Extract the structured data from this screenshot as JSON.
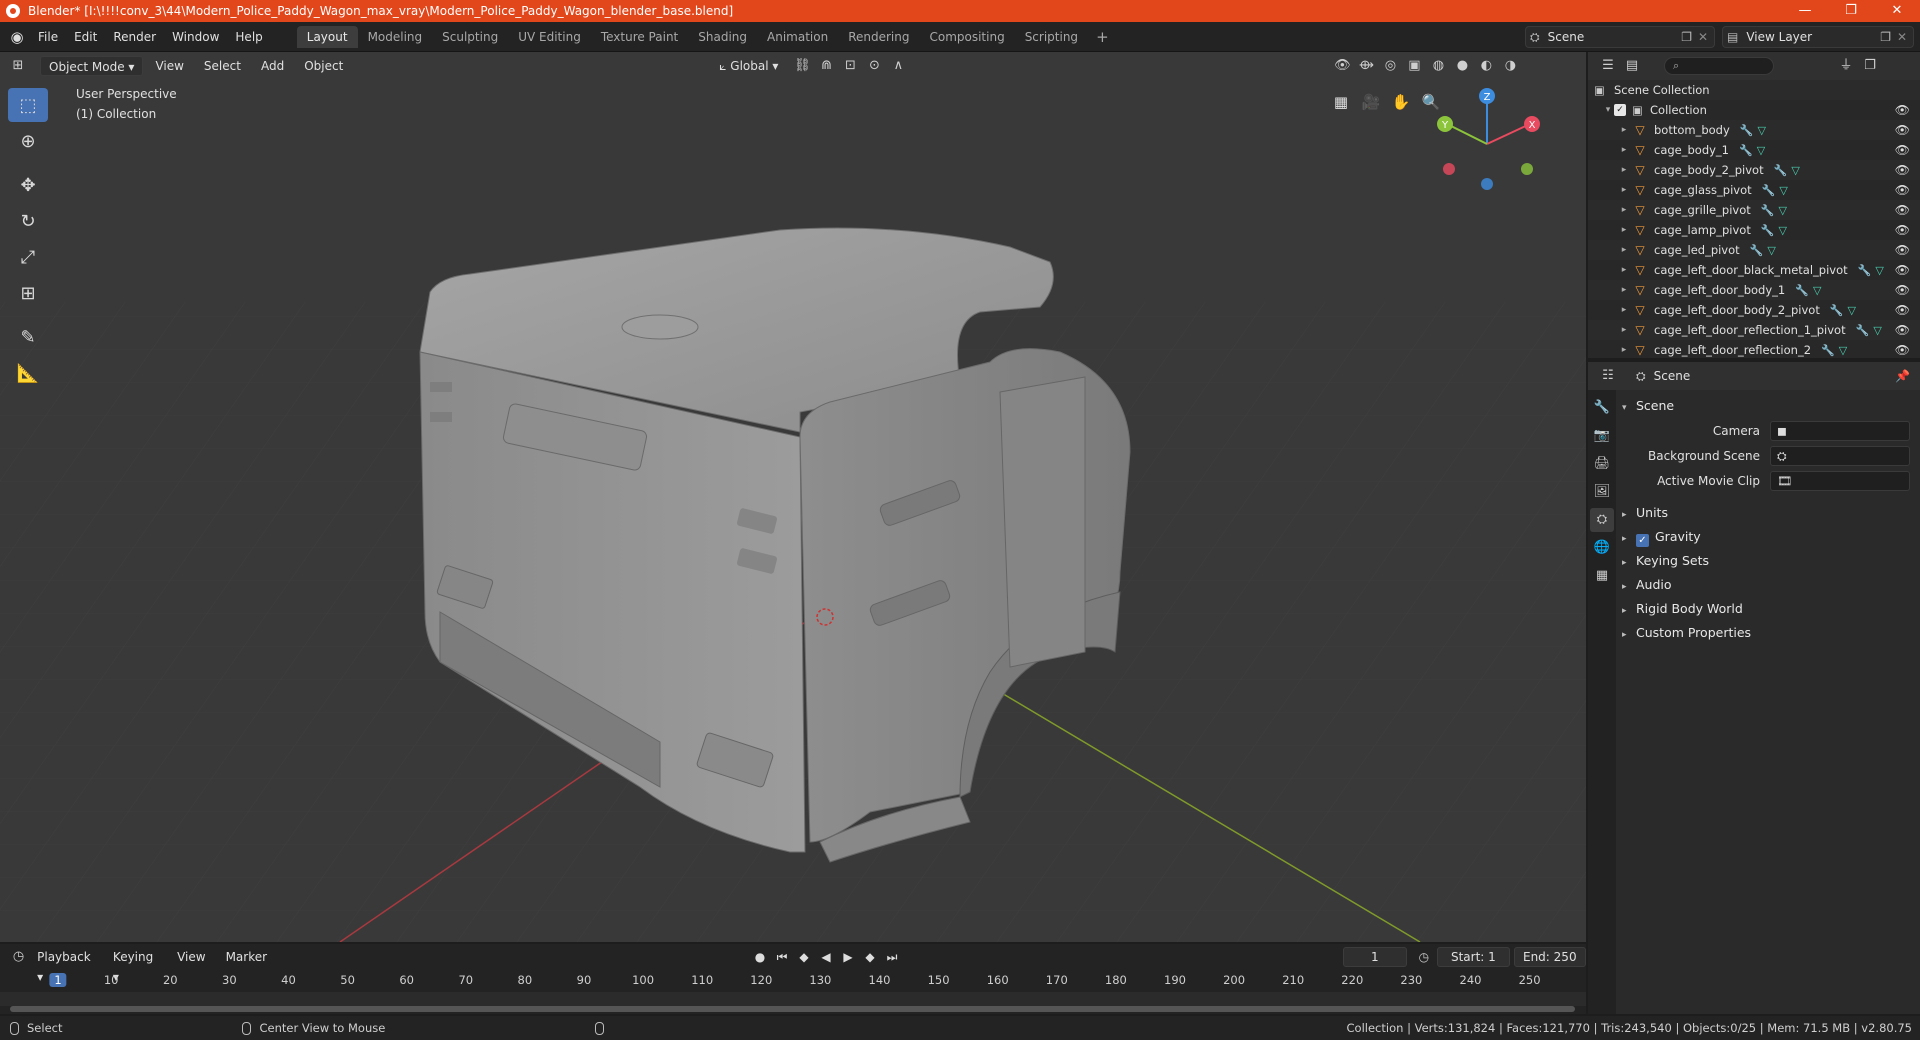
{
  "window": {
    "title": "Blender* [I:\\!!!!conv_3\\44\\Modern_Police_Paddy_Wagon_max_vray\\Modern_Police_Paddy_Wagon_blender_base.blend]",
    "minimize": "—",
    "maximize": "❐",
    "close": "✕"
  },
  "menu": [
    "File",
    "Edit",
    "Render",
    "Window",
    "Help"
  ],
  "workspaces": [
    "Layout",
    "Modeling",
    "Sculpting",
    "UV Editing",
    "Texture Paint",
    "Shading",
    "Animation",
    "Rendering",
    "Compositing",
    "Scripting"
  ],
  "active_workspace": "Layout",
  "scene_name": "Scene",
  "view_layer": "View Layer",
  "viewport_header": {
    "mode": "Object Mode",
    "menus": [
      "View",
      "Select",
      "Add",
      "Object"
    ],
    "orientation": "Global"
  },
  "viewport": {
    "perspective": "User Perspective",
    "collection": "(1) Collection",
    "gizmo_axes": [
      "X",
      "Y",
      "Z"
    ]
  },
  "outliner": {
    "root": "Scene Collection",
    "collection": "Collection",
    "items": [
      "bottom_body",
      "cage_body_1",
      "cage_body_2_pivot",
      "cage_glass_pivot",
      "cage_grille_pivot",
      "cage_lamp_pivot",
      "cage_led_pivot",
      "cage_left_door_black_metal_pivot",
      "cage_left_door_body_1",
      "cage_left_door_body_2_pivot",
      "cage_left_door_reflection_1_pivot",
      "cage_left_door_reflection_2"
    ]
  },
  "properties": {
    "context": "Scene",
    "panel": "Scene",
    "fields": [
      {
        "label": "Camera",
        "value": ""
      },
      {
        "label": "Background Scene",
        "value": ""
      },
      {
        "label": "Active Movie Clip",
        "value": ""
      }
    ],
    "subpanels": [
      "Units",
      "Gravity",
      "Keying Sets",
      "Audio",
      "Rigid Body World",
      "Custom Properties"
    ],
    "gravity_checked": true
  },
  "timeline": {
    "menus": [
      "Playback",
      "Keying",
      "View",
      "Marker"
    ],
    "current_frame": "1",
    "start_label": "Start:",
    "start": "1",
    "end_label": "End:",
    "end": "250",
    "ruler": [
      "1",
      "10",
      "20",
      "30",
      "40",
      "50",
      "60",
      "70",
      "80",
      "90",
      "100",
      "110",
      "120",
      "130",
      "140",
      "150",
      "160",
      "170",
      "180",
      "190",
      "200",
      "210",
      "220",
      "230",
      "240",
      "250"
    ]
  },
  "statusbar": {
    "select": "Select",
    "center": "Center View to Mouse",
    "stats": "Collection | Verts:131,824 | Faces:121,770 | Tris:243,540 | Objects:0/25 | Mem: 71.5 MB | v2.80.75"
  },
  "colors": {
    "titlebar": "#e2461b",
    "accent": "#4772b3",
    "object_icon": "#f09a3c",
    "axis_x": "#e84a5f",
    "axis_y": "#8cc43c",
    "axis_z": "#3c8ce0"
  }
}
